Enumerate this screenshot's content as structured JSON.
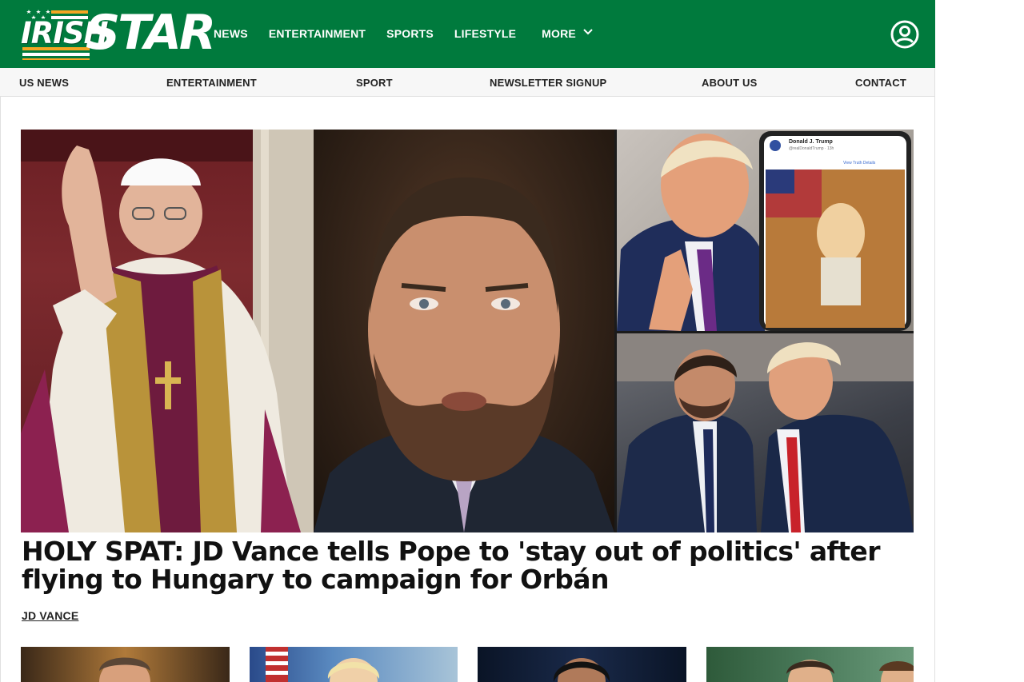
{
  "brand": {
    "logo_word1": "IRISH",
    "logo_word2": "STAR",
    "primary_color": "#007a3d",
    "accent_color": "#f5a623"
  },
  "main_nav": {
    "items": [
      {
        "label": "NEWS"
      },
      {
        "label": "ENTERTAINMENT"
      },
      {
        "label": "SPORTS"
      },
      {
        "label": "LIFESTYLE"
      }
    ],
    "more_label": "MORE",
    "more_icon": "chevron-down-icon",
    "account_icon": "user-account-icon"
  },
  "sub_nav": {
    "items": [
      {
        "label": "US NEWS"
      },
      {
        "label": "ENTERTAINMENT"
      },
      {
        "label": "SPORT"
      },
      {
        "label": "NEWSLETTER SIGNUP"
      },
      {
        "label": "ABOUT US"
      },
      {
        "label": "CONTACT"
      }
    ]
  },
  "lead_story": {
    "headline": "HOLY SPAT: JD Vance tells Pope to 'stay out of politics' after flying to Hungary to campaign for Orbán",
    "tag": "JD VANCE"
  },
  "collage": {
    "post_author": "Donald J. Trump",
    "post_handle": "@realDonaldTrump · 13h",
    "post_link": "View Truth Details"
  }
}
